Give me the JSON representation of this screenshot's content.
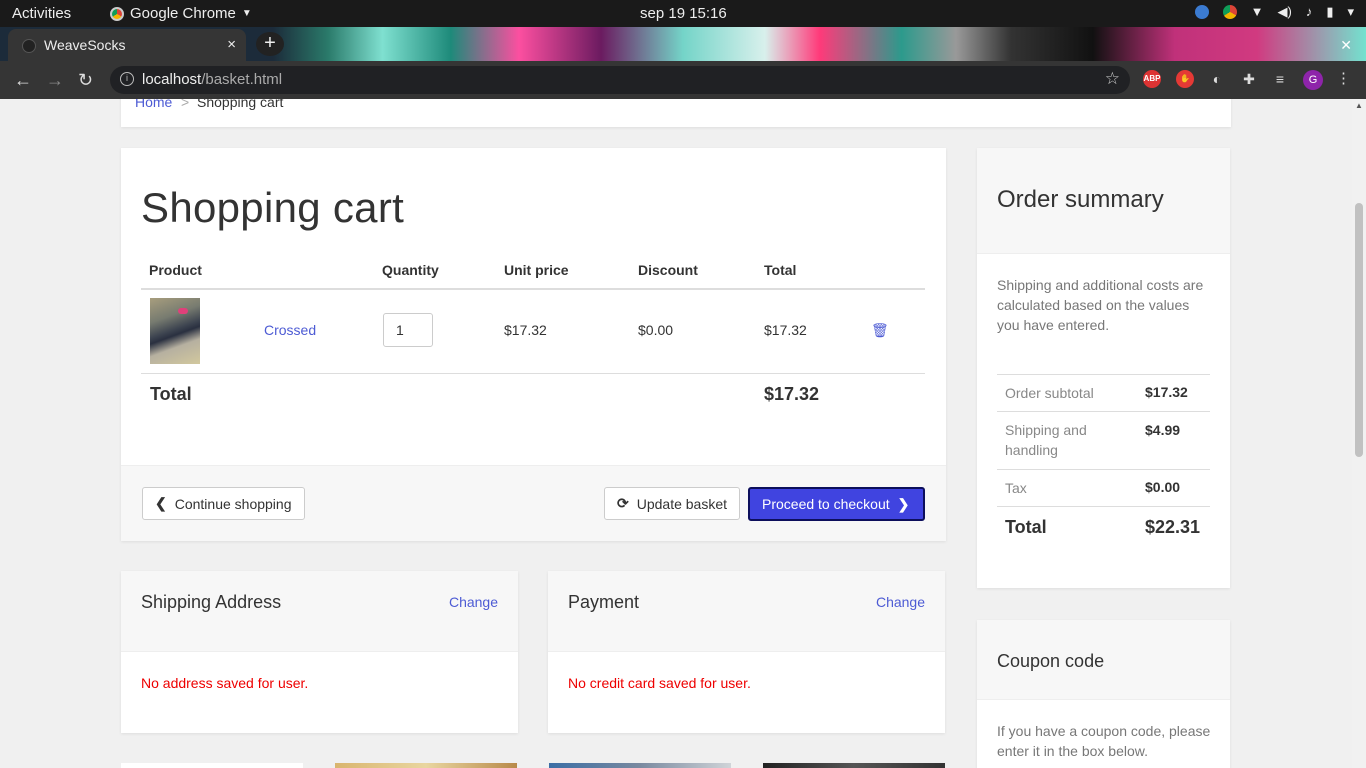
{
  "system_bar": {
    "activities": "Activities",
    "app_name": "Google Chrome",
    "clock": "sep 19  15:16"
  },
  "browser": {
    "tab_title": "WeaveSocks",
    "tab_close": "×",
    "new_tab": "+",
    "url_host": "localhost",
    "url_path": "/basket.html",
    "ext_abp": "ABP",
    "avatar_letter": "G"
  },
  "breadcrumb": {
    "home": "Home",
    "separator": ">",
    "current": "Shopping cart"
  },
  "cart": {
    "title": "Shopping cart",
    "headers": {
      "product": "Product",
      "quantity": "Quantity",
      "unit_price": "Unit price",
      "discount": "Discount",
      "total": "Total"
    },
    "items": [
      {
        "name": "Crossed",
        "quantity": "1",
        "unit_price": "$17.32",
        "discount": "$0.00",
        "total": "$17.32"
      }
    ],
    "total_label": "Total",
    "total_value": "$17.32",
    "continue_label": "Continue shopping",
    "update_label": "Update basket",
    "checkout_label": "Proceed to checkout"
  },
  "summary": {
    "title": "Order summary",
    "note": "Shipping and additional costs are calculated based on the values you have entered.",
    "rows": [
      {
        "label": "Order subtotal",
        "value": "$17.32"
      },
      {
        "label": "Shipping and handling",
        "value": "$4.99"
      },
      {
        "label": "Tax",
        "value": "$0.00"
      },
      {
        "label": "Total",
        "value": "$22.31"
      }
    ]
  },
  "coupon": {
    "title": "Coupon code",
    "note": "If you have a coupon code, please enter it in the box below."
  },
  "shipping": {
    "title": "Shipping Address",
    "change": "Change",
    "message": "No address saved for user."
  },
  "payment": {
    "title": "Payment",
    "change": "Change",
    "message": "No credit card saved for user."
  },
  "colors": {
    "link": "#4d5bd4",
    "primary_button": "#4044e0",
    "error": "#e00000"
  }
}
